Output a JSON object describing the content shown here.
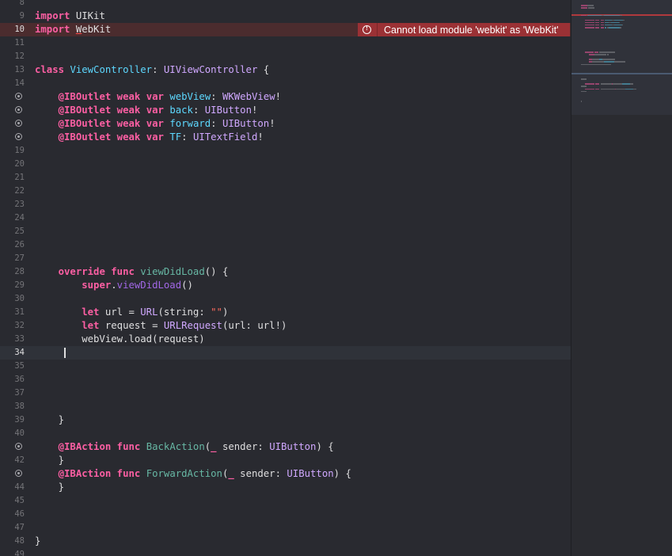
{
  "editor": {
    "lines": [
      {
        "n": "8",
        "tokens": []
      },
      {
        "n": "9",
        "tokens": [
          {
            "t": "import",
            "c": "kw"
          },
          {
            "t": " UIKit"
          }
        ]
      },
      {
        "n": "10",
        "state": "error",
        "tokens": [
          {
            "t": "import",
            "c": "kw"
          },
          {
            "t": " "
          },
          {
            "t": "W",
            "c": "err-underline"
          },
          {
            "t": "ebKit"
          }
        ]
      },
      {
        "n": "11",
        "tokens": []
      },
      {
        "n": "12",
        "tokens": []
      },
      {
        "n": "13",
        "tokens": [
          {
            "t": "class",
            "c": "kw"
          },
          {
            "t": " "
          },
          {
            "t": "ViewController",
            "c": "ty"
          },
          {
            "t": ": "
          },
          {
            "t": "UIViewController",
            "c": "sys"
          },
          {
            "t": " {"
          }
        ]
      },
      {
        "n": "14",
        "tokens": []
      },
      {
        "n": "15",
        "bp": true,
        "tokens": [
          {
            "t": "    "
          },
          {
            "t": "@IBOutlet",
            "c": "kw"
          },
          {
            "t": " "
          },
          {
            "t": "weak",
            "c": "kw"
          },
          {
            "t": " "
          },
          {
            "t": "var",
            "c": "kw"
          },
          {
            "t": " "
          },
          {
            "t": "webView",
            "c": "ty"
          },
          {
            "t": ": "
          },
          {
            "t": "WKWebView",
            "c": "sys"
          },
          {
            "t": "!"
          }
        ]
      },
      {
        "n": "16",
        "bp": true,
        "tokens": [
          {
            "t": "    "
          },
          {
            "t": "@IBOutlet",
            "c": "kw"
          },
          {
            "t": " "
          },
          {
            "t": "weak",
            "c": "kw"
          },
          {
            "t": " "
          },
          {
            "t": "var",
            "c": "kw"
          },
          {
            "t": " "
          },
          {
            "t": "back",
            "c": "ty"
          },
          {
            "t": ": "
          },
          {
            "t": "UIButton",
            "c": "sys"
          },
          {
            "t": "!"
          }
        ]
      },
      {
        "n": "17",
        "bp": true,
        "tokens": [
          {
            "t": "    "
          },
          {
            "t": "@IBOutlet",
            "c": "kw"
          },
          {
            "t": " "
          },
          {
            "t": "weak",
            "c": "kw"
          },
          {
            "t": " "
          },
          {
            "t": "var",
            "c": "kw"
          },
          {
            "t": " "
          },
          {
            "t": "forward",
            "c": "ty"
          },
          {
            "t": ": "
          },
          {
            "t": "UIButton",
            "c": "sys"
          },
          {
            "t": "!"
          }
        ]
      },
      {
        "n": "18",
        "bp": true,
        "tokens": [
          {
            "t": "    "
          },
          {
            "t": "@IBOutlet",
            "c": "kw"
          },
          {
            "t": " "
          },
          {
            "t": "weak",
            "c": "kw"
          },
          {
            "t": " "
          },
          {
            "t": "var",
            "c": "kw"
          },
          {
            "t": " "
          },
          {
            "t": "TF",
            "c": "ty"
          },
          {
            "t": ": "
          },
          {
            "t": "UITextField",
            "c": "sys"
          },
          {
            "t": "!"
          }
        ]
      },
      {
        "n": "19",
        "tokens": []
      },
      {
        "n": "20",
        "tokens": []
      },
      {
        "n": "21",
        "tokens": []
      },
      {
        "n": "22",
        "tokens": []
      },
      {
        "n": "23",
        "tokens": []
      },
      {
        "n": "24",
        "tokens": []
      },
      {
        "n": "25",
        "tokens": []
      },
      {
        "n": "26",
        "tokens": []
      },
      {
        "n": "27",
        "tokens": []
      },
      {
        "n": "28",
        "tokens": [
          {
            "t": "    "
          },
          {
            "t": "override",
            "c": "kw"
          },
          {
            "t": " "
          },
          {
            "t": "func",
            "c": "kw"
          },
          {
            "t": " "
          },
          {
            "t": "viewDidLoad",
            "c": "fn"
          },
          {
            "t": "() {"
          }
        ]
      },
      {
        "n": "29",
        "tokens": [
          {
            "t": "        "
          },
          {
            "t": "super",
            "c": "kw"
          },
          {
            "t": "."
          },
          {
            "t": "viewDidLoad",
            "c": "sysfn"
          },
          {
            "t": "()"
          }
        ]
      },
      {
        "n": "30",
        "tokens": []
      },
      {
        "n": "31",
        "tokens": [
          {
            "t": "        "
          },
          {
            "t": "let",
            "c": "kw"
          },
          {
            "t": " url = "
          },
          {
            "t": "URL",
            "c": "sys"
          },
          {
            "t": "(string: "
          },
          {
            "t": "\"\"",
            "c": "str"
          },
          {
            "t": ")"
          }
        ]
      },
      {
        "n": "32",
        "tokens": [
          {
            "t": "        "
          },
          {
            "t": "let",
            "c": "kw"
          },
          {
            "t": " request = "
          },
          {
            "t": "URLRequest",
            "c": "sys"
          },
          {
            "t": "(url: url!)"
          }
        ]
      },
      {
        "n": "33",
        "tokens": [
          {
            "t": "        webView.load(request)"
          }
        ]
      },
      {
        "n": "34",
        "state": "current",
        "caret": true,
        "tokens": []
      },
      {
        "n": "35",
        "tokens": []
      },
      {
        "n": "36",
        "tokens": []
      },
      {
        "n": "37",
        "tokens": []
      },
      {
        "n": "38",
        "tokens": []
      },
      {
        "n": "39",
        "tokens": [
          {
            "t": "    }"
          }
        ]
      },
      {
        "n": "40",
        "tokens": []
      },
      {
        "n": "41",
        "bp": true,
        "tokens": [
          {
            "t": "    "
          },
          {
            "t": "@IBAction",
            "c": "kw"
          },
          {
            "t": " "
          },
          {
            "t": "func",
            "c": "kw"
          },
          {
            "t": " "
          },
          {
            "t": "BackAction",
            "c": "fn"
          },
          {
            "t": "("
          },
          {
            "t": "_",
            "c": "kw"
          },
          {
            "t": " sender: "
          },
          {
            "t": "UIButton",
            "c": "sys"
          },
          {
            "t": ") {"
          }
        ]
      },
      {
        "n": "42",
        "tokens": [
          {
            "t": "    }"
          }
        ]
      },
      {
        "n": "43",
        "bp": true,
        "tokens": [
          {
            "t": "    "
          },
          {
            "t": "@IBAction",
            "c": "kw"
          },
          {
            "t": " "
          },
          {
            "t": "func",
            "c": "kw"
          },
          {
            "t": " "
          },
          {
            "t": "ForwardAction",
            "c": "fn"
          },
          {
            "t": "("
          },
          {
            "t": "_",
            "c": "kw"
          },
          {
            "t": " sender: "
          },
          {
            "t": "UIButton",
            "c": "sys"
          },
          {
            "t": ") {"
          }
        ]
      },
      {
        "n": "44",
        "tokens": [
          {
            "t": "    }"
          }
        ]
      },
      {
        "n": "45",
        "tokens": []
      },
      {
        "n": "46",
        "tokens": []
      },
      {
        "n": "47",
        "tokens": []
      },
      {
        "n": "48",
        "tokens": [
          {
            "t": "}"
          }
        ]
      },
      {
        "n": "49",
        "tokens": []
      }
    ],
    "error": {
      "line": "10",
      "message": "Cannot load module 'webkit' as 'WebKit'",
      "icon": "error-icon"
    }
  },
  "colors": {
    "background": "#292a30",
    "keyword": "#fc5fa3",
    "type": "#5dd8ff",
    "system_type": "#d0a8ff",
    "function": "#67b7a4",
    "string": "#fc6a5d",
    "error_badge": "#9b3135",
    "error_line": "#4b2c2e"
  }
}
